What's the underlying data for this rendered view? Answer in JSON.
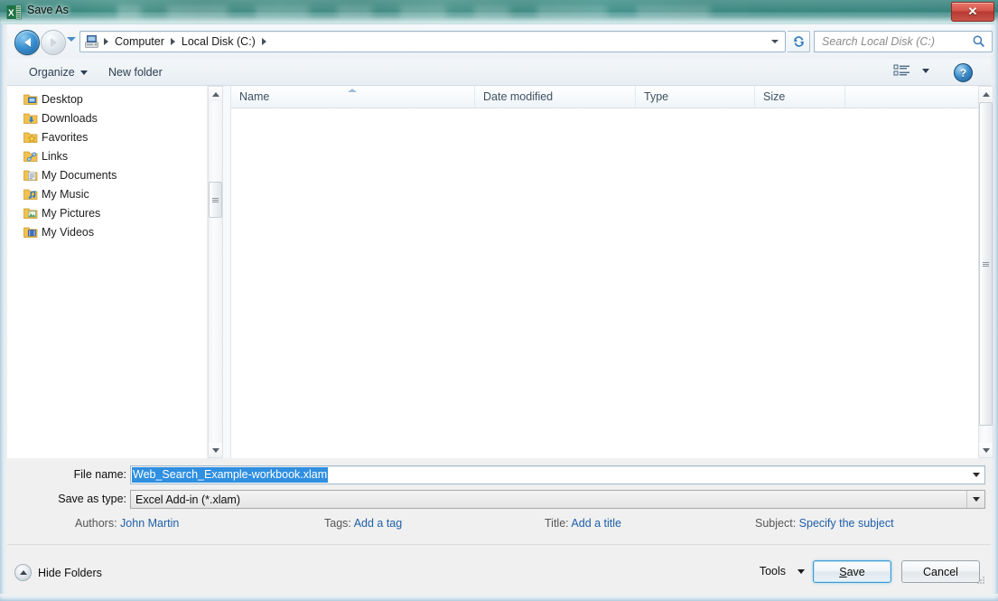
{
  "window": {
    "title": "Save As",
    "app_icon": "excel-icon",
    "close_label": "✕"
  },
  "nav": {
    "back_icon": "back-arrow-icon",
    "forward_icon": "forward-arrow-icon",
    "history_dropdown_icon": "chevron-down-icon",
    "refresh_icon": "refresh-icon",
    "breadcrumbs": [
      "Computer",
      "Local Disk (C:)"
    ],
    "address_dropdown_icon": "chevron-down-icon",
    "computer_icon": "computer-drive-icon"
  },
  "search": {
    "placeholder": "Search Local Disk (C:)",
    "icon": "search-icon"
  },
  "toolbar": {
    "organize_label": "Organize",
    "new_folder_label": "New folder",
    "view_icon": "view-mode-icon",
    "view_caret_icon": "chevron-down-icon",
    "help_label": "?",
    "help_icon": "help-icon"
  },
  "sidebar": {
    "items": [
      {
        "label": "Desktop",
        "icon": "desktop-folder-icon",
        "accent": "#3f7fbf"
      },
      {
        "label": "Downloads",
        "icon": "downloads-folder-icon",
        "accent": "#2f7fd0"
      },
      {
        "label": "Favorites",
        "icon": "favorites-folder-icon",
        "accent": "#f0b429"
      },
      {
        "label": "Links",
        "icon": "links-folder-icon",
        "accent": "#3f8fd8"
      },
      {
        "label": "My Documents",
        "icon": "documents-folder-icon",
        "accent": "#b9c6d4"
      },
      {
        "label": "My Music",
        "icon": "music-folder-icon",
        "accent": "#2f7fd0"
      },
      {
        "label": "My Pictures",
        "icon": "pictures-folder-icon",
        "accent": "#4f9f5f"
      },
      {
        "label": "My Videos",
        "icon": "videos-folder-icon",
        "accent": "#3f6fbf"
      }
    ]
  },
  "file_list": {
    "columns": [
      {
        "label": "Name",
        "sorted": "asc"
      },
      {
        "label": "Date modified",
        "sorted": ""
      },
      {
        "label": "Type",
        "sorted": ""
      },
      {
        "label": "Size",
        "sorted": ""
      }
    ],
    "rows": []
  },
  "form": {
    "file_name_label": "File name:",
    "file_name_value": "Web_Search_Example-workbook.xlam",
    "file_name_selected": true,
    "save_as_type_label": "Save as type:",
    "save_as_type_value": "Excel Add-in (*.xlam)",
    "dropdown_icon": "chevron-down-icon"
  },
  "metadata": {
    "authors_label": "Authors:",
    "authors_value": "John Martin",
    "tags_label": "Tags:",
    "tags_value": "Add a tag",
    "title_label": "Title:",
    "title_value": "Add a title",
    "subject_label": "Subject:",
    "subject_value": "Specify the subject"
  },
  "footer": {
    "hide_folders_label": "Hide Folders",
    "hide_folders_icon": "collapse-up-icon",
    "tools_label": "Tools",
    "tools_caret_icon": "chevron-down-icon",
    "save_label": "Save",
    "save_accel": "S",
    "cancel_label": "Cancel"
  },
  "colors": {
    "titlebar": "#2f8078",
    "selection": "#2f8fe0",
    "link": "#1f5fa8",
    "accent_button_border": "#3c9dd3",
    "close_button": "#c85449"
  }
}
